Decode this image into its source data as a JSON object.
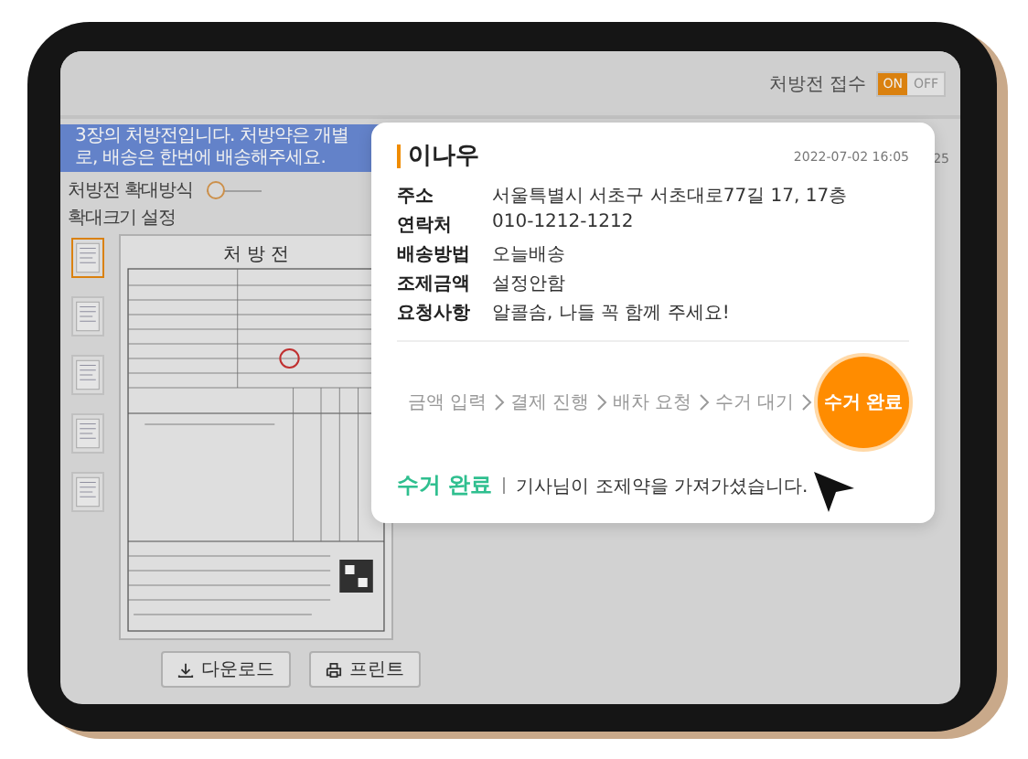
{
  "top_bar": {
    "label": "처방전 접수",
    "toggle": [
      {
        "label": "ON",
        "selected": true
      },
      {
        "label": "OFF",
        "selected": false
      }
    ]
  },
  "banner": "3장의 처방전입니다. 처방약은 개별로, 배송은 한번에 배송해주세요.",
  "zoom": {
    "label": "처방전 확대방식",
    "level": 0,
    "size_label": "확대크기 설정"
  },
  "thumbnails": [
    {
      "selected": true
    },
    {
      "selected": false
    },
    {
      "selected": false
    },
    {
      "selected": false
    },
    {
      "selected": false
    }
  ],
  "document": {
    "title": "처 방 전"
  },
  "side_fragment": "25",
  "buttons": [
    {
      "kind": "download",
      "label": "다운로드"
    },
    {
      "kind": "print",
      "label": "프린트"
    }
  ],
  "modal": {
    "name": "이나우",
    "date": "2022-07-02 16:05",
    "fields": [
      {
        "label": "주소",
        "value": "서울특별시 서초구 서초대로77길 17, 17층"
      },
      {
        "label": "연락처",
        "value": "010-1212-1212"
      },
      {
        "label": "배송방법",
        "value": "오늘배송"
      },
      {
        "label": "조제금액",
        "value": "설정안함"
      },
      {
        "label": "요청사항",
        "value": "알콜솜, 나들 꼭 함께 주세요!"
      }
    ],
    "steps": [
      {
        "label": "금액 입력",
        "selected": false
      },
      {
        "label": "결제 진행",
        "selected": false
      },
      {
        "label": "배차 요청",
        "selected": false
      },
      {
        "label": "수거 대기",
        "selected": false
      },
      {
        "label": "수거 완료",
        "selected": true
      }
    ],
    "status": {
      "title": "수거 완료",
      "message": "기사님이 조제약을 가져가셨습니다."
    }
  }
}
